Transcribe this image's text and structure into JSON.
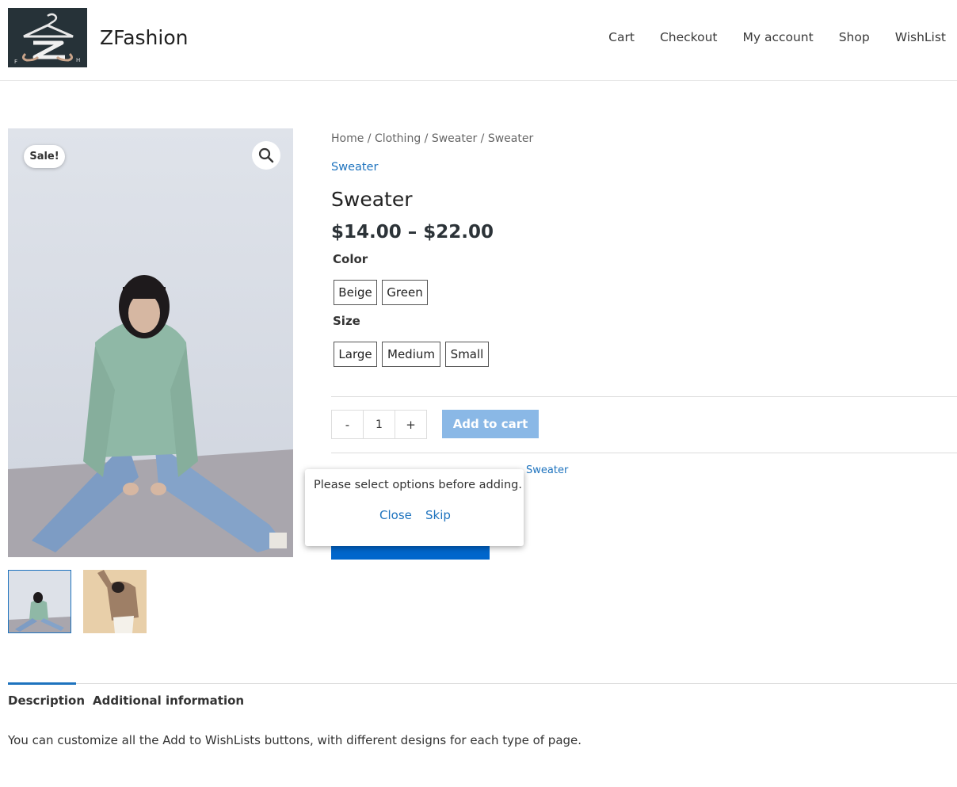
{
  "header": {
    "site_title": "ZFashion",
    "logo_letters": [
      "F",
      "H"
    ],
    "nav": [
      "Cart",
      "Checkout",
      "My account",
      "Shop",
      "WishList"
    ]
  },
  "gallery": {
    "sale_badge": "Sale!",
    "zoom_icon": "magnifier-icon"
  },
  "summary": {
    "breadcrumb": "Home / Clothing / Sweater / Sweater",
    "category_link": "Sweater",
    "title": "Sweater",
    "price": "$14.00 – $22.00",
    "color_label": "Color",
    "colors": [
      "Beige",
      "Green"
    ],
    "size_label": "Size",
    "sizes": [
      "Large",
      "Medium",
      "Small"
    ],
    "qty_minus": "-",
    "qty_value": "1",
    "qty_plus": "+",
    "add_to_cart": "Add to cart",
    "meta_category": "Sweater"
  },
  "popup": {
    "message": "Please select options before adding.",
    "close": "Close",
    "skip": "Skip"
  },
  "tabs": {
    "items": [
      "Description",
      "Additional information"
    ],
    "active": "Description",
    "description_text": "You can customize all the Add to WishLists buttons, with different designs for each type of page."
  },
  "colors": {
    "accent": "#1e73be",
    "add_to_cart_bg": "#8ab8e6",
    "wishlist_button_bg": "#0066cc"
  }
}
